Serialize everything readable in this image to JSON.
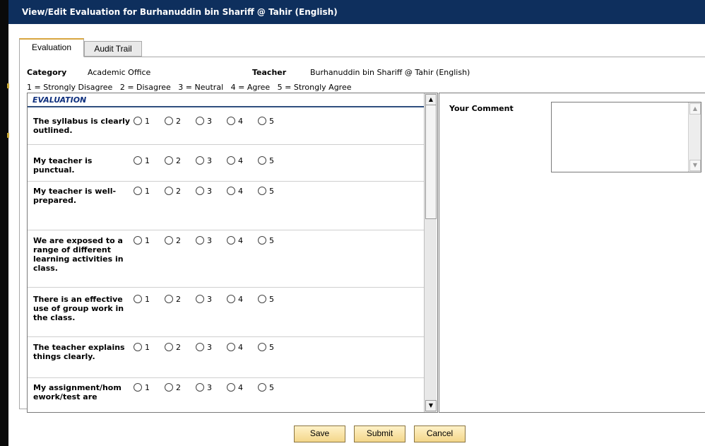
{
  "window": {
    "title": "View/Edit Evaluation for Burhanuddin bin Shariff @ Tahir (English)"
  },
  "tabs": [
    {
      "label": "Evaluation",
      "active": true
    },
    {
      "label": "Audit Trail",
      "active": false
    }
  ],
  "info": {
    "category_label": "Category",
    "category_value": "Academic Office",
    "teacher_label": "Teacher",
    "teacher_value": "Burhanuddin bin Shariff @ Tahir (English)"
  },
  "scale_legend": "1 = Strongly Disagree   2 = Disagree   3 = Neutral   4 = Agree   5 = Strongly Agree",
  "evaluation": {
    "header": "EVALUATION",
    "options": [
      "1",
      "2",
      "3",
      "4",
      "5"
    ],
    "questions": [
      {
        "text": "The syllabus is clearly outlined."
      },
      {
        "text": "My teacher is punctual."
      },
      {
        "text": "My teacher is well-prepared."
      },
      {
        "text": "We are exposed to a range of different learning activities in class."
      },
      {
        "text": "There is an effective use of group work in the class."
      },
      {
        "text": "The teacher explains things clearly."
      },
      {
        "text": "My assignment/homework/test are"
      }
    ]
  },
  "comment": {
    "label": "Your Comment",
    "value": ""
  },
  "buttons": {
    "save": "Save",
    "submit": "Submit",
    "cancel": "Cancel"
  },
  "colors": {
    "titlebar": "#0e2f5d",
    "button": "#f3d68a",
    "tab_accent": "#d8a640"
  },
  "icons": {
    "scroll_up": "scroll-up-arrow-icon",
    "scroll_down": "scroll-down-arrow-icon"
  }
}
